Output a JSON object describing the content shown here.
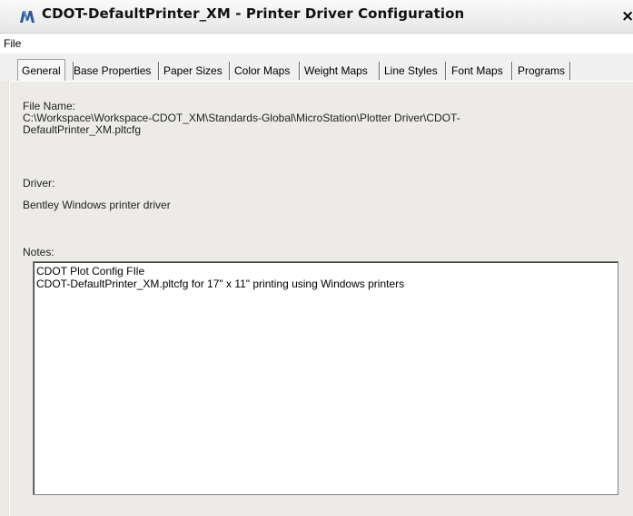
{
  "window": {
    "title": "CDOT-DefaultPrinter_XM - Printer Driver Configuration",
    "close_glyph": "×",
    "icon": "microstation-icon"
  },
  "menu": {
    "file_label": "File"
  },
  "tabs": [
    {
      "label": "General",
      "active": true
    },
    {
      "label": "Base Properties"
    },
    {
      "label": "Paper Sizes"
    },
    {
      "label": "Color Maps"
    },
    {
      "label": "Weight Maps"
    },
    {
      "label": "Line Styles"
    },
    {
      "label": "Font Maps"
    },
    {
      "label": "Programs"
    }
  ],
  "general": {
    "file_name_label": "File Name:",
    "file_name_line1": "C:\\Workspace\\Workspace-CDOT_XM\\Standards-Global\\MicroStation\\Plotter Driver\\CDOT-",
    "file_name_line2": "DefaultPrinter_XM.pltcfg",
    "driver_label": "Driver:",
    "driver_value": "Bentley Windows printer driver",
    "notes_label": "Notes:",
    "notes_line1": "CDOT Plot Config FIle",
    "notes_line2": "CDOT-DefaultPrinter_XM.pltcfg for 17\" x 11\" printing using Windows printers"
  },
  "colors": {
    "icon_blue": "#2a5a9e",
    "window_bg": "#ece9e3"
  }
}
